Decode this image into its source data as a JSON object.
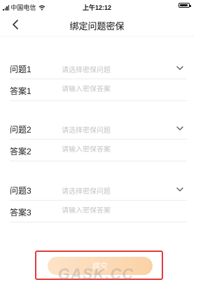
{
  "status_bar": {
    "carrier": "中国电信",
    "time": "上午12:12",
    "battery_level": 0.9
  },
  "nav": {
    "title": "绑定问题密保",
    "back_icon": "chevron-left-icon"
  },
  "groups": [
    {
      "question_label": "问题1",
      "question_placeholder": "请选择密保问题",
      "answer_label": "答案1",
      "answer_placeholder": "请输入密保答案"
    },
    {
      "question_label": "问题2",
      "question_placeholder": "请选择密保问题",
      "answer_label": "答案2",
      "answer_placeholder": "请输入密保答案"
    },
    {
      "question_label": "问题3",
      "question_placeholder": "请选择密保问题",
      "answer_label": "答案3",
      "answer_placeholder": "请输入密保答案"
    }
  ],
  "submit_label": "提交",
  "watermark": "GASK.CC",
  "colors": {
    "highlight_box": "#e23a3a",
    "button_bg": "#fbd9b4",
    "placeholder": "#c4c4c4"
  }
}
